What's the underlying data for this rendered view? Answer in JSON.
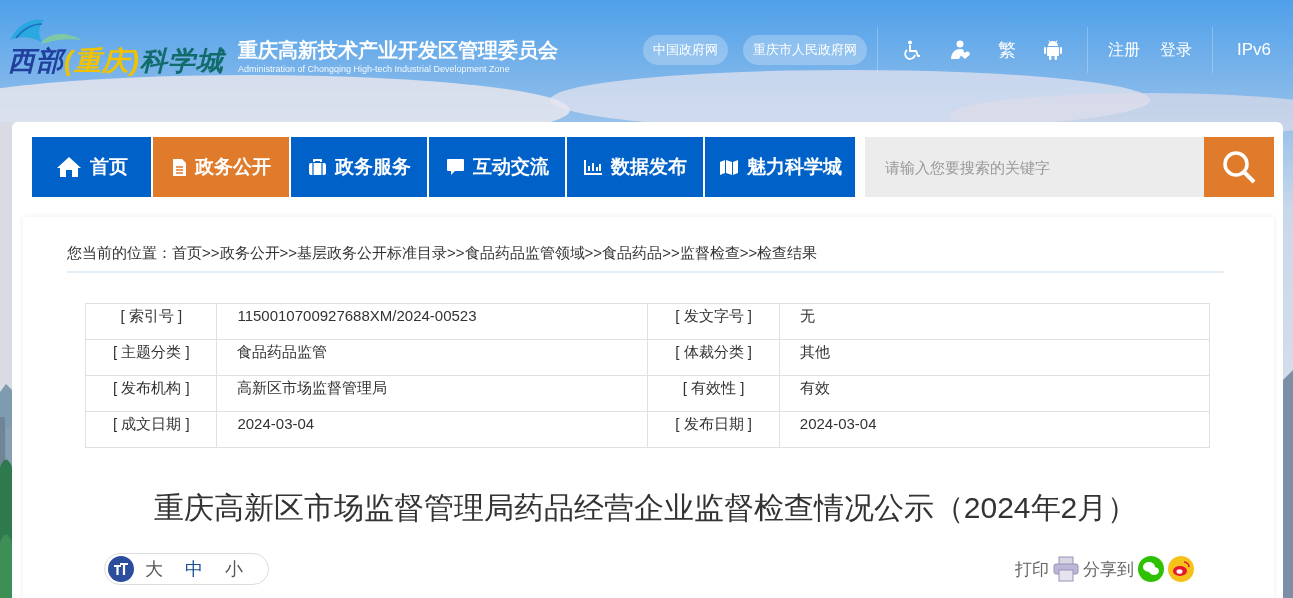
{
  "header": {
    "logo": [
      {
        "text": "西部",
        "color": "#213f9c"
      },
      {
        "text": "(重庆)",
        "color": "#f2c200"
      },
      {
        "text": "科学城",
        "color": "#116b6a"
      }
    ],
    "org_name": "重庆高新技术产业开发区管理委员会",
    "org_name_en": "Administration of Chongqing High-tech Industrial Development Zone",
    "top_links": [
      "中国政府网",
      "重庆市人民政府网"
    ],
    "tools": [
      {
        "kind": "accessibility"
      },
      {
        "kind": "elderly"
      },
      {
        "kind": "text",
        "label": "繁"
      },
      {
        "kind": "android"
      }
    ],
    "account": [
      "注册",
      "登录"
    ],
    "ipv6": "IPv6"
  },
  "nav": [
    {
      "label": "首页",
      "kind": "home",
      "selected": false
    },
    {
      "label": "政务公开",
      "kind": "document",
      "selected": true
    },
    {
      "label": "政务服务",
      "kind": "briefcase",
      "selected": false
    },
    {
      "label": "互动交流",
      "kind": "chat",
      "selected": false
    },
    {
      "label": "数据发布",
      "kind": "chart",
      "selected": false
    },
    {
      "label": "魅力科学城",
      "kind": "map",
      "selected": false
    }
  ],
  "search": {
    "placeholder": "请输入您要搜索的关键字"
  },
  "breadcrumb": {
    "label": "您当前的位置：",
    "separator": ">>",
    "items": [
      "首页",
      "政务公开",
      "基层政务公开标准目录",
      "食品药品监管领域",
      "食品药品",
      "监督检查",
      "检查结果"
    ]
  },
  "meta_table": [
    [
      "[ 索引号 ]",
      "1150010700927688XM/2024-00523",
      "[ 发文字号 ]",
      "无"
    ],
    [
      "[ 主题分类 ]",
      "食品药品监管",
      "[ 体裁分类 ]",
      "其他"
    ],
    [
      "[ 发布机构 ]",
      "高新区市场监督管理局",
      "[ 有效性 ]",
      "有效"
    ],
    [
      "[ 成文日期 ]",
      "2024-03-04",
      "[ 发布日期 ]",
      "2024-03-04"
    ]
  ],
  "title": "重庆高新区市场监督管理局药品经营企业监督检查情况公示（2024年2月）",
  "font_size": [
    {
      "label": "大",
      "selected": false
    },
    {
      "label": "中",
      "selected": true
    },
    {
      "label": "小",
      "selected": false
    }
  ],
  "print_label": "打印",
  "share_label": "分享到"
}
